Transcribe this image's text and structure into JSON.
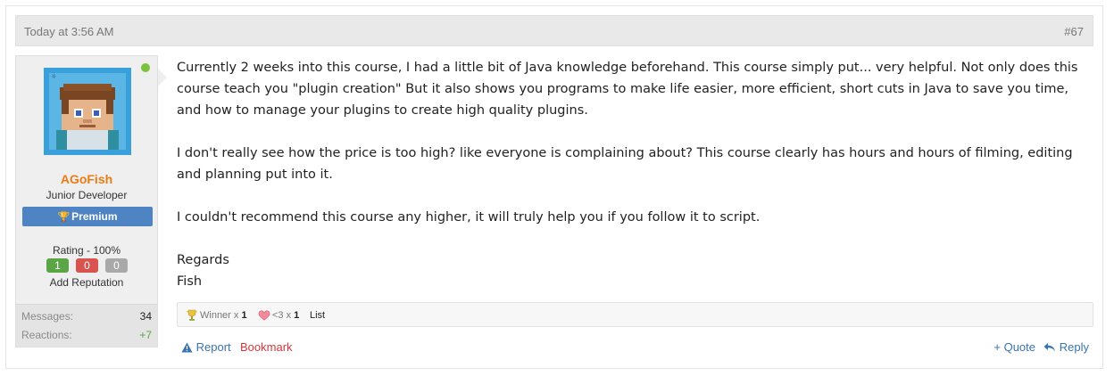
{
  "post": {
    "date": "Today at 3:56 AM",
    "number": "#67"
  },
  "user": {
    "name": "AGoFish",
    "title": "Junior Developer",
    "badge": "Premium",
    "rating_label": "Rating - 100%",
    "rep_positive": "1",
    "rep_negative": "0",
    "rep_neutral": "0",
    "add_reputation": "Add Reputation",
    "stats": [
      {
        "label": "Messages:",
        "value": "34"
      },
      {
        "label": "Reactions:",
        "value": "+7"
      }
    ],
    "online": true,
    "colors": {
      "name": "#e97c16",
      "badge": "#4f84c4",
      "online": "#7cc13b"
    }
  },
  "message": {
    "paragraphs": [
      "Currently 2 weeks into this course, I had a little bit of Java knowledge beforehand. This course simply put... very helpful. Not only does this course teach you \"plugin creation\" But it also shows you programs to make life easier, more efficient, short cuts in Java to save you time, and how to manage your plugins to create high quality plugins.",
      "I don't really see how the price is too high? like everyone is complaining about? This course clearly has hours and hours of filming, editing and planning put into it.",
      "I couldn't recommend this course any higher, it will truly help you if you follow it to script.",
      "Regards",
      "Fish"
    ]
  },
  "reactions": {
    "items": [
      {
        "icon": "trophy-icon",
        "label": "Winner",
        "times": "x",
        "count": "1"
      },
      {
        "icon": "heart-icon",
        "label": "<3",
        "times": "x",
        "count": "1"
      }
    ],
    "list_label": "List"
  },
  "actions": {
    "report": "Report",
    "bookmark": "Bookmark",
    "quote": "+ Quote",
    "reply": "Reply"
  }
}
